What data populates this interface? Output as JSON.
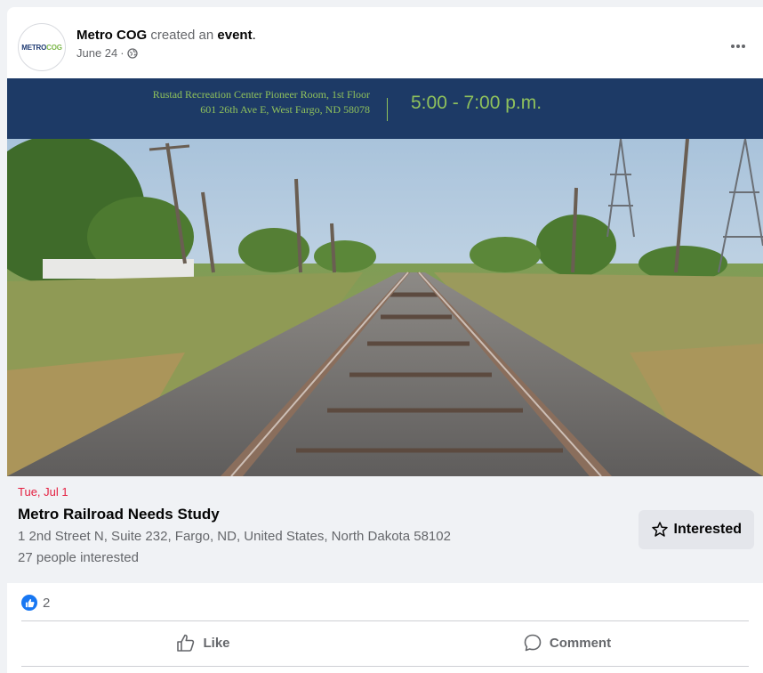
{
  "post": {
    "author": "Metro COG",
    "action_text": " created an ",
    "object_text": "event",
    "period": ".",
    "date": "June 24",
    "date_separator": " · ",
    "avatar_logo": {
      "metro": "METRO",
      "cog": "COG"
    },
    "more_icon": "more-horizontal-icon",
    "privacy_icon": "globe-icon"
  },
  "banner": {
    "venue_line1": "Rustad Recreation Center Pioneer Room, 1st Floor",
    "venue_line2": "601 26th Ave E, West Fargo, ND 58078",
    "time": "5:00 - 7:00 p.m."
  },
  "event": {
    "date": "Tue, Jul 1",
    "title": "Metro Railroad Needs Study",
    "location": "1 2nd Street N, Suite 232, Fargo, ND, United States, North Dakota 58102",
    "interested_count": "27 people interested",
    "interested_button": "Interested"
  },
  "reactions": {
    "count": "2",
    "icon": "like-reaction-icon"
  },
  "actions": {
    "like": "Like",
    "comment": "Comment"
  },
  "colors": {
    "brand_blue": "#1877f2",
    "date_red": "#e41e3f",
    "banner_navy": "#1d3a66",
    "banner_green": "#8fc15c"
  }
}
